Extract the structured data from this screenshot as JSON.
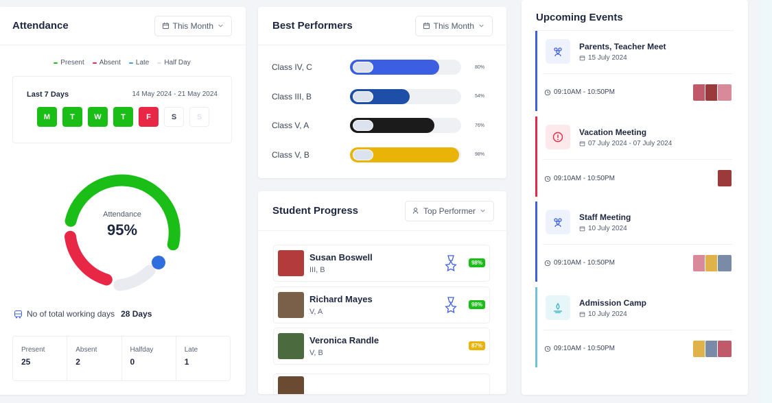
{
  "attendance": {
    "title": "Attendance",
    "filter": "This Month",
    "legend": [
      {
        "label": "Present",
        "color": "#1abe17"
      },
      {
        "label": "Absent",
        "color": "#e82646"
      },
      {
        "label": "Late",
        "color": "#3d9ae4"
      },
      {
        "label": "Half Day",
        "color": "#dfe2e9"
      }
    ],
    "last7_label": "Last 7 Days",
    "date_range": "14 May 2024 - 21 May 2024",
    "days": [
      {
        "letter": "M",
        "status": "present"
      },
      {
        "letter": "T",
        "status": "present"
      },
      {
        "letter": "W",
        "status": "present"
      },
      {
        "letter": "T",
        "status": "present"
      },
      {
        "letter": "F",
        "status": "absent"
      },
      {
        "letter": "S",
        "status": "empty"
      },
      {
        "letter": "S",
        "status": "faded"
      }
    ],
    "donut_label": "Attendance",
    "donut_value": "95%",
    "working_days_label": "No of total working days",
    "working_days_value": "28 Days",
    "stats": [
      {
        "label": "Present",
        "value": "25"
      },
      {
        "label": "Absent",
        "value": "2"
      },
      {
        "label": "Halfday",
        "value": "0"
      },
      {
        "label": "Late",
        "value": "1"
      }
    ]
  },
  "best_performers": {
    "title": "Best Performers",
    "filter": "This Month",
    "rows": [
      {
        "name": "Class IV, C",
        "percent": "80%",
        "fraction": 0.8,
        "color": "#3b5fe0"
      },
      {
        "name": "Class III, B",
        "percent": "54%",
        "fraction": 0.54,
        "color": "#1d4fa8"
      },
      {
        "name": "Class V, A",
        "percent": "76%",
        "fraction": 0.76,
        "color": "#1b1b1b"
      },
      {
        "name": "Class V, B",
        "percent": "98%",
        "fraction": 0.98,
        "color": "#eab308"
      }
    ]
  },
  "student_progress": {
    "title": "Student Progress",
    "filter": "Top Performer",
    "students": [
      {
        "name": "Susan Boswell",
        "class": "III, B",
        "score": "98%",
        "badge_color": "#1abe17",
        "medal": true
      },
      {
        "name": "Richard Mayes",
        "class": "V, A",
        "score": "98%",
        "badge_color": "#1abe17",
        "medal": true
      },
      {
        "name": "Veronica Randle",
        "class": "V, B",
        "score": "87%",
        "badge_color": "#eab308",
        "medal": false
      }
    ]
  },
  "events": {
    "title": "Upcoming Events",
    "items": [
      {
        "title": "Parents, Teacher Meet",
        "date": "15 July 2024",
        "time": "09:10AM - 10:50PM",
        "accent": "#3d5ee1",
        "icon": "users-icon",
        "icon_bg": "#eef2fd",
        "attendees": 3
      },
      {
        "title": "Vacation Meeting",
        "date": "07 July 2024 - 07 July 2024",
        "time": "09:10AM - 10:50PM",
        "accent": "#e82646",
        "icon": "vacation-icon",
        "icon_bg": "#fde9ec",
        "attendees": 1
      },
      {
        "title": "Staff Meeting",
        "date": "10 July 2024",
        "time": "09:10AM - 10:50PM",
        "accent": "#3d5ee1",
        "icon": "users-icon",
        "icon_bg": "#eef2fd",
        "attendees": 3
      },
      {
        "title": "Admission Camp",
        "date": "10 July 2024",
        "time": "09:10AM - 10:50PM",
        "accent": "#6fc3d8",
        "icon": "camp-icon",
        "icon_bg": "#e6f6f9",
        "attendees": 3
      }
    ]
  }
}
